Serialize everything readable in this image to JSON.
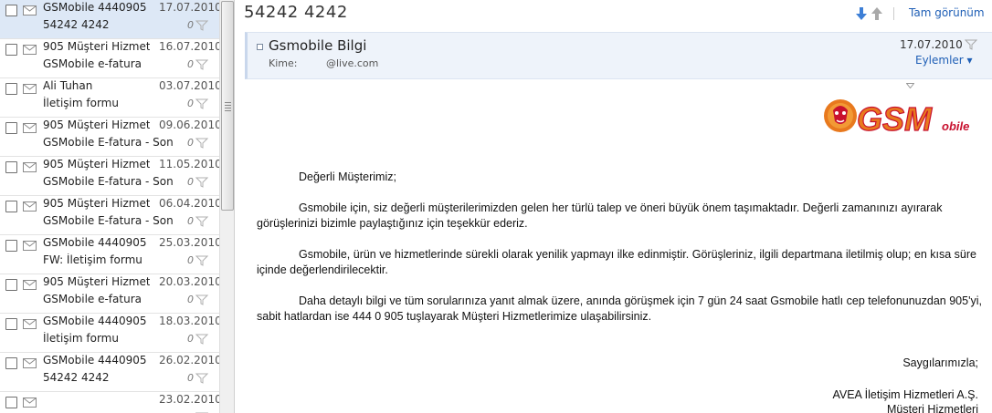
{
  "messages": [
    {
      "sender": "GSMobile 4440905",
      "date": "17.07.2010",
      "subject": "54242  4242",
      "selected": true
    },
    {
      "sender": "905 Müşteri Hizmetl...",
      "date": "16.07.2010",
      "subject": "GSMobile e-fatura",
      "selected": false
    },
    {
      "sender": "Ali Tuhan",
      "date": "03.07.2010",
      "subject": "İletişim formu",
      "selected": false
    },
    {
      "sender": "905 Müşteri Hizmetl...",
      "date": "09.06.2010",
      "subject": "GSMobile E-fatura - Son...",
      "selected": false
    },
    {
      "sender": "905 Müşteri Hizmetl...",
      "date": "11.05.2010",
      "subject": "GSMobile E-fatura - Son...",
      "selected": false
    },
    {
      "sender": "905 Müşteri Hizmetl...",
      "date": "06.04.2010",
      "subject": "GSMobile E-fatura - Son...",
      "selected": false
    },
    {
      "sender": "GSMobile 4440905",
      "date": "25.03.2010",
      "subject": "FW: İletişim formu",
      "selected": false
    },
    {
      "sender": "905 Müşteri Hizmetl...",
      "date": "20.03.2010",
      "subject": "GSMobile e-fatura",
      "selected": false
    },
    {
      "sender": "GSMobile 4440905",
      "date": "18.03.2010",
      "subject": "İletişim formu",
      "selected": false
    },
    {
      "sender": "GSMobile 4440905",
      "date": "26.02.2010",
      "subject": "54242  4242",
      "selected": false
    },
    {
      "sender": "",
      "date": "23.02.2010",
      "subject": "",
      "selected": false
    }
  ],
  "reading": {
    "subject": "54242  4242",
    "full_view": "Tam görünüm",
    "from_name": "Gsmobile Bilgi",
    "to_label": "Kime:",
    "to_address": "@live.com",
    "date": "17.07.2010",
    "actions": "Eylemler ▾"
  },
  "logo": {
    "main": "GSM",
    "sub": "obile"
  },
  "body": {
    "greeting": "Değerli Müşterimiz;",
    "p1": "Gsmobile için, siz değerli müşterilerimizden gelen her türlü talep ve öneri büyük önem taşımaktadır. Değerli zamanınızı ayırarak görüşlerinizi bizimle paylaştığınız için teşekkür ederiz.",
    "p2": "Gsmobile, ürün ve hizmetlerinde sürekli olarak yenilik yapmayı ilke edinmiştir. Görüşleriniz, ilgili departmana iletilmiş olup; en kısa süre içinde değerlendirilecektir.",
    "p3": "Daha detaylı bilgi ve tüm sorularınıza yanıt almak üzere, anında görüşmek için 7 gün 24 saat Gsmobile hatlı cep telefonunuzdan 905'yi, sabit hatlardan ise 444 0 905 tuşlayarak Müşteri Hizmetlerimize ulaşabilirsiniz.",
    "closing": "Saygılarımızla;",
    "sig1": "AVEA İletişim Hizmetleri A.Ş.",
    "sig2": "Müşteri Hizmetleri"
  },
  "colors": {
    "accent": "#1f5fb6",
    "selected_row": "#dde8f6",
    "header_bg": "#eef3fa",
    "logo_orange": "#e8791e",
    "logo_red": "#c8102e"
  }
}
